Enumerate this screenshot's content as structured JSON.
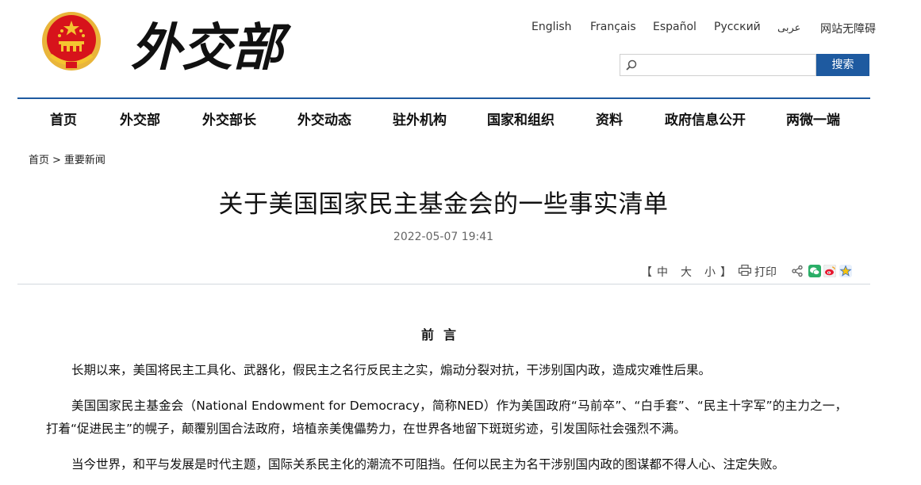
{
  "header": {
    "logo_text": "外交部",
    "languages": [
      "English",
      "Français",
      "Español",
      "Русский",
      "عربى",
      "网站无障碍"
    ],
    "search": {
      "placeholder": "",
      "button_label": "搜索"
    }
  },
  "nav": {
    "items": [
      "首页",
      "外交部",
      "外交部长",
      "外交动态",
      "驻外机构",
      "国家和组织",
      "资料",
      "政府信息公开",
      "两微一端"
    ]
  },
  "breadcrumb": {
    "home": "首页",
    "separator": ">",
    "current": "重要新闻"
  },
  "article": {
    "title": "关于美国国家民主基金会的一些事实清单",
    "date": "2022-05-07 19:41",
    "font_controls": {
      "open": "【",
      "small": "中",
      "medium": "大",
      "large": "小",
      "close": "】"
    },
    "print_label": "打印",
    "section_heading": "前言",
    "paragraphs": [
      "长期以来，美国将民主工具化、武器化，假民主之名行反民主之实，煽动分裂对抗，干涉别国内政，造成灾难性后果。",
      "美国国家民主基金会（National Endowment for Democracy，简称NED）作为美国政府“马前卒”、“白手套”、“民主十字军”的主力之一，打着“促进民主”的幌子，颠覆别国合法政府，培植亲美傀儡势力，在世界各地留下斑斑劣迹，引发国际社会强烈不满。",
      "当今世界，和平与发展是时代主题，国际关系民主化的潮流不可阻挡。任何以民主为名干涉别国内政的图谋都不得人心、注定失败。"
    ]
  },
  "icons": [
    "national-emblem-icon",
    "search-icon",
    "print-icon",
    "share-icon",
    "wechat-icon",
    "weibo-icon",
    "qzone-icon"
  ],
  "colors": {
    "accent": "#1e5aa0",
    "emblem_red": "#d7131b",
    "emblem_gold": "#f4c430"
  }
}
